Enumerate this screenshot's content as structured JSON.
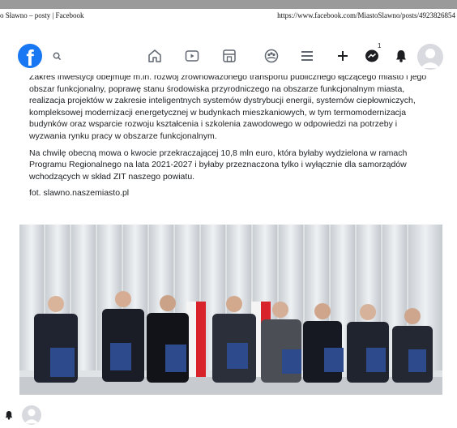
{
  "window": {
    "title": "o Sławno – posty | Facebook",
    "url": "https://www.facebook.com/MiastoSlawno/posts/4923826854"
  },
  "nav": {
    "logo_letter": "f",
    "icons": [
      "search-icon",
      "home-icon",
      "watch-icon",
      "marketplace-icon",
      "groups-icon",
      "menu-icon",
      "create-icon",
      "messenger-icon",
      "notifications-icon"
    ],
    "messenger_badge": "1"
  },
  "post": {
    "paragraph1": "Zakres inwestycji obejmuje m.in. rozwój zrównoważonego transportu publicznego łączącego miasto i jego obszar funkcjonalny, poprawę stanu środowiska przyrodniczego na obszarze funkcjonalnym miasta, realizacja projektów w zakresie inteligentnych systemów dystrybucji energii, systemów ciepłowniczych, kompleksowej modernizacji energetycznej w budynkach mieszkaniowych, w tym termomodernizacja budynków oraz wsparcie rozwoju kształcenia i szkolenia zawodowego w odpowiedzi na potrzeby i wyzwania rynku pracy w obszarze funkcjonalnym.",
    "paragraph2": "Na chwilę obecną mowa o kwocie przekraczającej 10,8 mln euro, która byłaby wydzielona w ramach Programu Regionalnego na lata 2021-2027 i byłaby przeznaczona tylko i wyłącznie dla samorządów wchodzących w skład ZIT naszego powiatu.",
    "credit": "fot. slawno.naszemiasto.pl"
  },
  "colors": {
    "brand": "#1877f2",
    "titlebar_gray": "#9a9a9a",
    "icon_gray": "#606770"
  }
}
